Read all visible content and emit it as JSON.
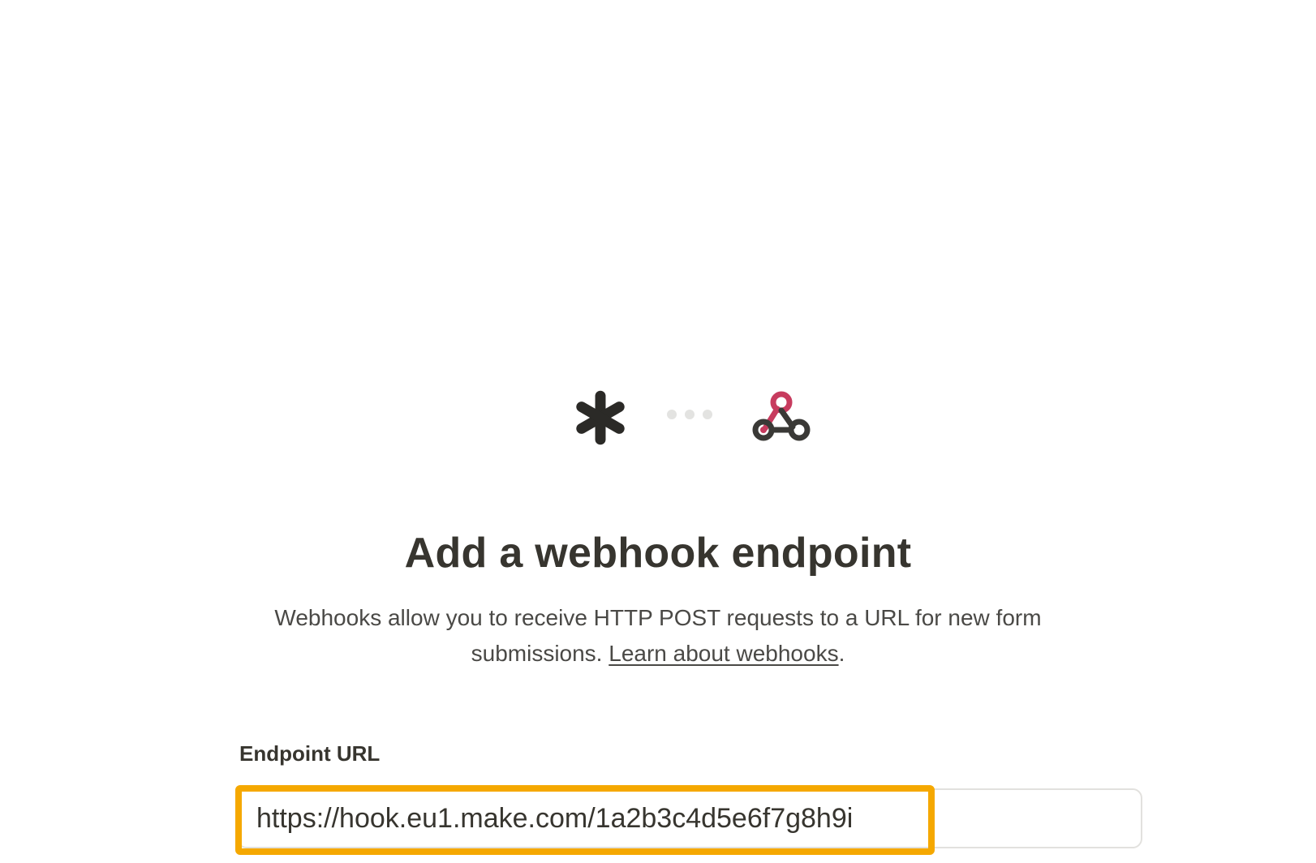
{
  "logos": {
    "left_icon": "asterisk-logo-icon",
    "connector": "dots-connector-icon",
    "right_icon": "webhook-icon"
  },
  "heading": {
    "title": "Add a webhook endpoint",
    "description_prefix": "Webhooks allow you to receive HTTP POST requests to a URL for new form submissions. ",
    "learn_link": "Learn about webhooks",
    "description_suffix": "."
  },
  "endpoint": {
    "label": "Endpoint URL",
    "value": "https://hook.eu1.make.com/1a2b3c4d5e6f7g8h9i"
  },
  "colors": {
    "highlight": "#f5a800",
    "webhook_accent": "#c73b5e",
    "text": "#37352f"
  }
}
